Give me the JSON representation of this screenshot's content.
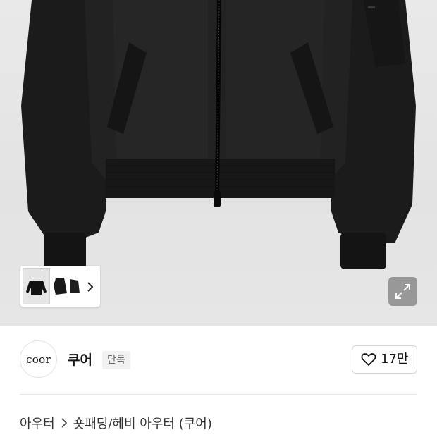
{
  "hero": {
    "thumbnails": [
      {
        "icon": "jacket-front-thumb-icon"
      },
      {
        "icon": "jacket-side-thumb-icon"
      },
      {
        "icon": "jacket-back-thumb-icon"
      }
    ],
    "next_icon": "chevron-right-icon",
    "expand_icon": "expand-icon"
  },
  "brand": {
    "logo_text": "coor",
    "name": "쿠어",
    "badge": "단독"
  },
  "like": {
    "icon": "heart-outline-icon",
    "count": "17만"
  },
  "breadcrumb": {
    "items": [
      "아우터",
      "숏패딩/헤비 아우터 (쿠어)"
    ],
    "separator_icon": "chevron-right-icon"
  },
  "colors": {
    "background": "#ffffff",
    "hero_background": "#e6e6e6",
    "text_primary": "#111111",
    "badge_background": "#f1f1f1"
  }
}
